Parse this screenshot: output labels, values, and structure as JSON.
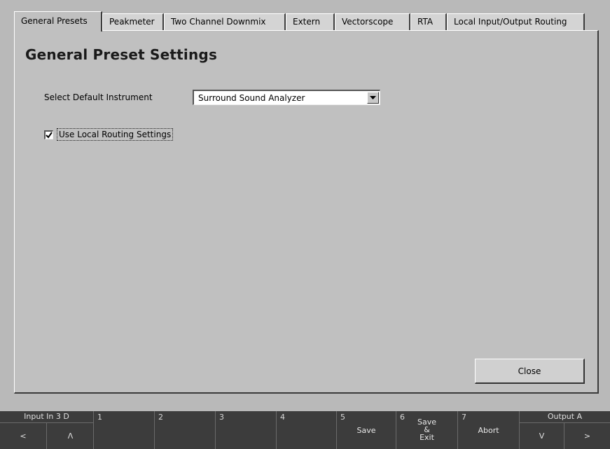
{
  "tabs": [
    {
      "label": "General Presets",
      "active": true
    },
    {
      "label": "Peakmeter",
      "active": false
    },
    {
      "label": "Two Channel Downmix",
      "active": false
    },
    {
      "label": "Extern",
      "active": false
    },
    {
      "label": "Vectorscope",
      "active": false
    },
    {
      "label": "RTA",
      "active": false
    },
    {
      "label": "Local Input/Output Routing",
      "active": false
    }
  ],
  "panel": {
    "title": "General Preset Settings",
    "instrument_label": "Select Default Instrument",
    "instrument_value": "Surround Sound Analyzer",
    "checkbox_label": "Use Local Routing Settings",
    "checkbox_checked": true,
    "close_label": "Close"
  },
  "bottom": {
    "input": {
      "title": "Input In 3 D",
      "prev": "<",
      "up": "Λ"
    },
    "keys": [
      {
        "num": "1",
        "label": ""
      },
      {
        "num": "2",
        "label": ""
      },
      {
        "num": "3",
        "label": ""
      },
      {
        "num": "4",
        "label": ""
      },
      {
        "num": "5",
        "label": "Save"
      },
      {
        "num": "6",
        "label": "Save\n&\nExit"
      },
      {
        "num": "7",
        "label": "Abort"
      }
    ],
    "output": {
      "title": "Output A",
      "down": "V",
      "next": ">"
    }
  }
}
